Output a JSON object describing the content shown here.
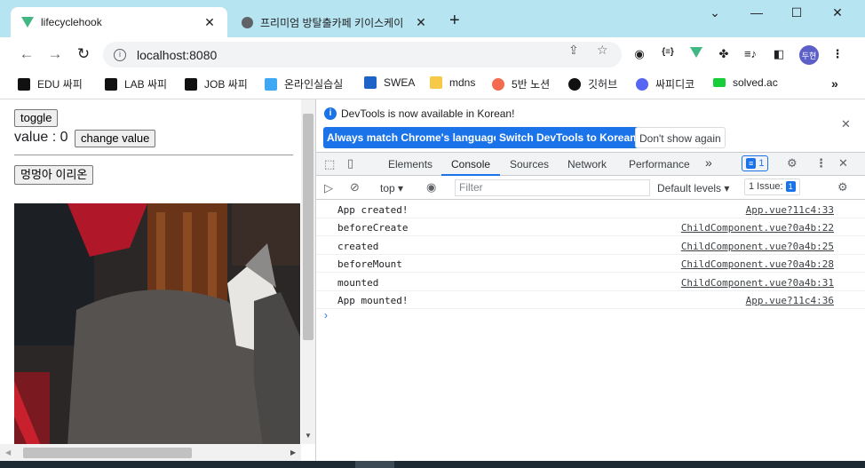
{
  "browser": {
    "tabs": [
      {
        "title": "lifecyclehook",
        "active": true
      },
      {
        "title": "프리미엄 방탈출카페 키이스케이",
        "active": false
      }
    ],
    "new_tab": "+",
    "window_controls": {
      "collapse": "⌄",
      "minimize": "—",
      "maximize": "☐",
      "close": "✕"
    },
    "url": "localhost:8080",
    "profile": "두현",
    "bookmarks": [
      {
        "label": "EDU 싸피",
        "color": "#111111"
      },
      {
        "label": "LAB 싸피",
        "color": "#111111"
      },
      {
        "label": "JOB 싸피",
        "color": "#111111"
      },
      {
        "label": "온라인실습실",
        "color": "#3ea8f5"
      },
      {
        "label": "SWEA",
        "color": "#1e64c8"
      },
      {
        "label": "mdns",
        "color": "#f7c948"
      },
      {
        "label": "5반 노션",
        "color": "#f46a4e"
      },
      {
        "label": "깃허브",
        "color": "#111111"
      },
      {
        "label": "싸피디코",
        "color": "#5865f2"
      },
      {
        "label": "solved.ac",
        "color": "#17ce3a"
      }
    ],
    "bookmark_overflow": "»"
  },
  "app": {
    "toggle_label": "toggle",
    "value_text": "value : 0",
    "change_value_label": "change value",
    "dog_button_label": "멍멍아 이리온"
  },
  "devtools": {
    "notice": {
      "message": "DevTools is now available in Korean!",
      "match_button": "Always match Chrome's language",
      "switch_button": "Switch DevTools to Korean",
      "dont_show_button": "Don't show again"
    },
    "tabs": [
      "Elements",
      "Console",
      "Sources",
      "Network",
      "Performance"
    ],
    "active_tab": "Console",
    "more_tabs": "»",
    "issues_count": "1",
    "context": "top",
    "filter_placeholder": "Filter",
    "levels": "Default levels",
    "issues_label": "1 Issue:",
    "issues_badge": "1",
    "logs": [
      {
        "message": "App created!",
        "source": "App.vue?11c4:33"
      },
      {
        "message": "beforeCreate",
        "source": "ChildComponent.vue?0a4b:22"
      },
      {
        "message": "created",
        "source": "ChildComponent.vue?0a4b:25"
      },
      {
        "message": "beforeMount",
        "source": "ChildComponent.vue?0a4b:28"
      },
      {
        "message": "mounted",
        "source": "ChildComponent.vue?0a4b:31"
      },
      {
        "message": "App mounted!",
        "source": "App.vue?11c4:36"
      }
    ],
    "prompt": "›"
  }
}
